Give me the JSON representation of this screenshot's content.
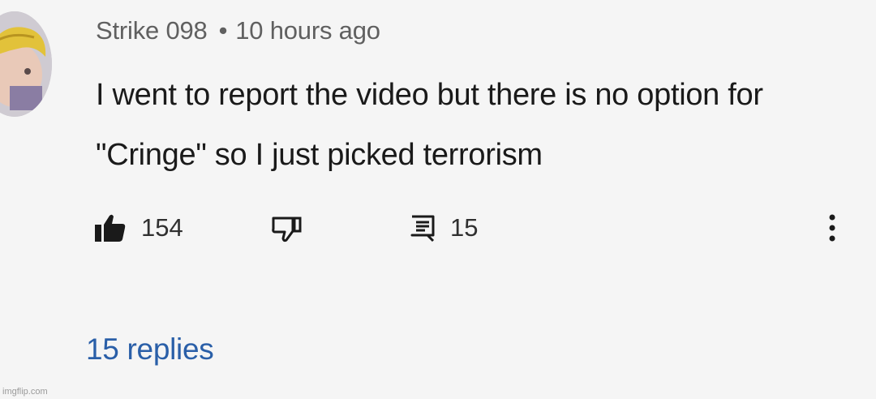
{
  "comment": {
    "author": "Strike 098",
    "separator": "•",
    "timestamp": "10 hours ago",
    "text": "I went to report the video but there is no option for \"Cringe\" so I just picked terrorism"
  },
  "actions": {
    "like_icon": "thumbs-up-filled-icon",
    "like_count": "154",
    "dislike_icon": "thumbs-down-outline-icon",
    "reply_icon": "comment-icon",
    "reply_count": "15",
    "more_icon": "vertical-ellipsis-icon"
  },
  "replies": {
    "label": "15 replies"
  },
  "watermark": "imgflip.com",
  "colors": {
    "background": "#f5f5f5",
    "author": "#606060",
    "text": "#1a1a1a",
    "replies_link": "#2a5fa8"
  }
}
